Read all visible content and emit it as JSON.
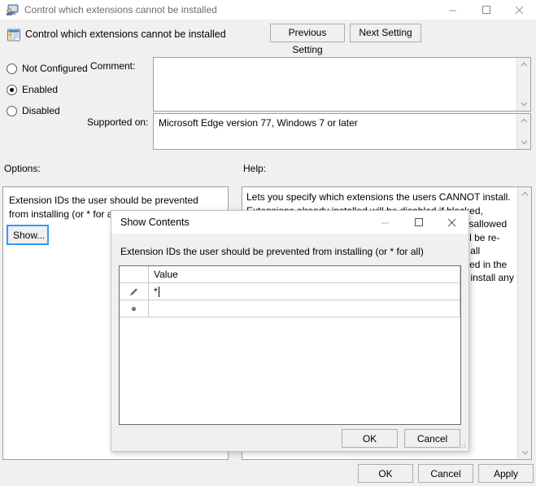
{
  "window": {
    "title": "Control which extensions cannot be installed",
    "icon": "policy-computer-icon",
    "controls": {
      "minimize": "minimize-icon",
      "maximize": "maximize-icon",
      "close": "close-icon"
    }
  },
  "header": {
    "setting_name": "Control which extensions cannot be installed",
    "icon": "policy-setting-icon",
    "previous_setting": "Previous Setting",
    "next_setting": "Next Setting"
  },
  "state": {
    "options": [
      {
        "label": "Not Configured",
        "selected": false
      },
      {
        "label": "Enabled",
        "selected": true
      },
      {
        "label": "Disabled",
        "selected": false
      }
    ]
  },
  "fields": {
    "comment_label": "Comment:",
    "comment_value": "",
    "supported_label": "Supported on:",
    "supported_value": "Microsoft Edge version 77, Windows 7 or later"
  },
  "panes": {
    "options_label": "Options:",
    "help_label": "Help:",
    "options_description": "Extension IDs the user should be prevented from installing (or * for all)",
    "show_button": "Show...",
    "help_text": "Lets you specify which extensions the users CANNOT install. Extensions already installed will be disabled if blocked, without a way for the user to enable them. After a disallowed extension has been removed from the blocklist it will be re-enabled automatically. A blocklist value of '*' means all extensions are blocked unless they are explicitly listed in the allowlist. If this policy is not configured the user can install any extension in Microsoft Edge."
  },
  "buttons": {
    "ok": "OK",
    "cancel": "Cancel",
    "apply": "Apply"
  },
  "modal": {
    "title": "Show Contents",
    "label": "Extension IDs the user should be prevented from installing (or * for all)",
    "grid": {
      "row_header_column": "",
      "columns": [
        "Value"
      ],
      "rows": [
        {
          "marker": "edit-pencil-icon",
          "value": "*",
          "editing": true
        },
        {
          "marker": "new-row-asterisk-icon",
          "value": "",
          "editing": false
        }
      ]
    },
    "ok": "OK",
    "cancel": "Cancel",
    "resize_grip": "resize-grip-icon",
    "controls": {
      "minimize": "minimize-icon",
      "maximize": "maximize-icon",
      "close": "close-icon"
    }
  },
  "colors": {
    "window_bg": "#f0f0f0",
    "pane_bg": "#ffffff",
    "focus_ring": "#3399ff",
    "border": "#a0a0a0",
    "title_text": "#6d6d6d"
  }
}
